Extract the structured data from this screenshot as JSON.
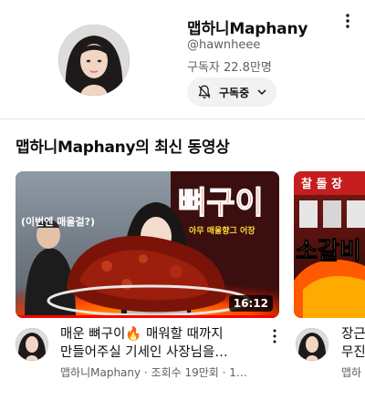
{
  "channel": {
    "name": "맵하니Maphany",
    "handle": "@hawnheee",
    "subscribers": "구독자 22.8만명",
    "subscribe_label": "구독중",
    "icons": {
      "bell": "bell-off-icon",
      "chevron": "chevron-down-icon",
      "more": "more-vertical-icon"
    }
  },
  "section": {
    "title": "맵하니Maphany의 최신 동영상"
  },
  "videos": [
    {
      "title_line1": "매운 뼈구이🔥 매워할 때까지",
      "title_line2": "만들어주실 기세인 사장님을…",
      "meta": "맵하니Maphany · 조회수 19만회 · 1…",
      "duration": "16:12",
      "thumb_caption_big": "뼈구이",
      "thumb_caption_small": "아무 매울향그 어장",
      "thumb_bubble": "(이번엔 매울걸?)"
    },
    {
      "title_line1": "장근",
      "title_line2": "무진",
      "meta": "맵하",
      "thumb_caption_big": "소갈비",
      "thumb_sign": "찰 돌 장"
    }
  ],
  "colors": {
    "accent": "#ff0000",
    "text_primary": "#0f0f0f",
    "text_secondary": "#606060",
    "button_bg": "#f2f2f2"
  }
}
